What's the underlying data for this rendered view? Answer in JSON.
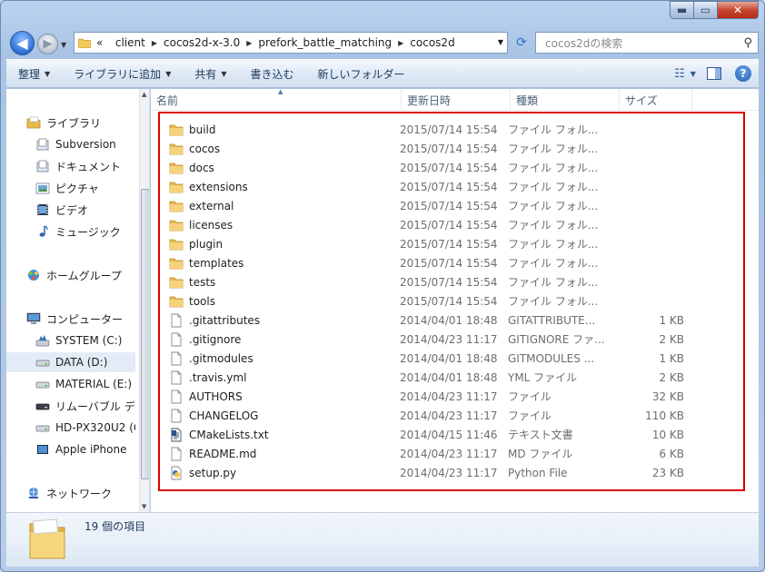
{
  "window": {
    "caption": {
      "minimize": "▬",
      "maximize": "▭",
      "close": "✕"
    }
  },
  "nav": {
    "back": "◀",
    "forward": "▶"
  },
  "address": {
    "overflow": "«",
    "crumbs": [
      "client",
      "cocos2d-x-3.0",
      "prefork_battle_matching",
      "cocos2d"
    ]
  },
  "search": {
    "placeholder": "cocos2dの検索"
  },
  "toolbar": {
    "items": [
      "整理",
      "ライブラリに追加",
      "共有",
      "書き込む",
      "新しいフォルダー"
    ]
  },
  "navpane": {
    "items": [
      {
        "label": "ライブラリ",
        "icon": "library-icon",
        "indent": 0
      },
      {
        "label": "Subversion",
        "icon": "document-library-icon",
        "indent": 1
      },
      {
        "label": "ドキュメント",
        "icon": "document-library-icon",
        "indent": 1
      },
      {
        "label": "ピクチャ",
        "icon": "pictures-icon",
        "indent": 1
      },
      {
        "label": "ビデオ",
        "icon": "video-icon",
        "indent": 1
      },
      {
        "label": "ミュージック",
        "icon": "music-icon",
        "indent": 1
      },
      {
        "label": "ホームグループ",
        "icon": "homegroup-icon",
        "indent": 0
      },
      {
        "label": "コンピューター",
        "icon": "computer-icon",
        "indent": 0
      },
      {
        "label": "SYSTEM (C:)",
        "icon": "system-drive-icon",
        "indent": 1
      },
      {
        "label": "DATA (D:)",
        "icon": "drive-icon",
        "indent": 1
      },
      {
        "label": "MATERIAL (E:)",
        "icon": "drive-icon",
        "indent": 1
      },
      {
        "label": "リムーバブル デ",
        "icon": "removable-drive-icon",
        "indent": 1
      },
      {
        "label": "HD-PX320U2 (G",
        "icon": "drive-icon",
        "indent": 1
      },
      {
        "label": "Apple iPhone",
        "icon": "phone-icon",
        "indent": 1
      },
      {
        "label": "ネットワーク",
        "icon": "network-icon",
        "indent": 0
      }
    ],
    "selected": "DATA (D:)"
  },
  "columns": {
    "name": "名前",
    "date": "更新日時",
    "type": "種類",
    "size": "サイズ"
  },
  "files": [
    {
      "name": "build",
      "date": "2015/07/14 15:54",
      "type": "ファイル フォル...",
      "size": "",
      "icon": "folder-icon"
    },
    {
      "name": "cocos",
      "date": "2015/07/14 15:54",
      "type": "ファイル フォル...",
      "size": "",
      "icon": "folder-icon"
    },
    {
      "name": "docs",
      "date": "2015/07/14 15:54",
      "type": "ファイル フォル...",
      "size": "",
      "icon": "folder-icon"
    },
    {
      "name": "extensions",
      "date": "2015/07/14 15:54",
      "type": "ファイル フォル...",
      "size": "",
      "icon": "folder-icon"
    },
    {
      "name": "external",
      "date": "2015/07/14 15:54",
      "type": "ファイル フォル...",
      "size": "",
      "icon": "folder-icon"
    },
    {
      "name": "licenses",
      "date": "2015/07/14 15:54",
      "type": "ファイル フォル...",
      "size": "",
      "icon": "folder-icon"
    },
    {
      "name": "plugin",
      "date": "2015/07/14 15:54",
      "type": "ファイル フォル...",
      "size": "",
      "icon": "folder-icon"
    },
    {
      "name": "templates",
      "date": "2015/07/14 15:54",
      "type": "ファイル フォル...",
      "size": "",
      "icon": "folder-icon"
    },
    {
      "name": "tests",
      "date": "2015/07/14 15:54",
      "type": "ファイル フォル...",
      "size": "",
      "icon": "folder-icon"
    },
    {
      "name": "tools",
      "date": "2015/07/14 15:54",
      "type": "ファイル フォル...",
      "size": "",
      "icon": "folder-icon"
    },
    {
      "name": ".gitattributes",
      "date": "2014/04/01 18:48",
      "type": "GITATTRIBUTE...",
      "size": "1 KB",
      "icon": "file-icon"
    },
    {
      "name": ".gitignore",
      "date": "2014/04/23 11:17",
      "type": "GITIGNORE ファ...",
      "size": "2 KB",
      "icon": "file-icon"
    },
    {
      "name": ".gitmodules",
      "date": "2014/04/01 18:48",
      "type": "GITMODULES ...",
      "size": "1 KB",
      "icon": "file-icon"
    },
    {
      "name": ".travis.yml",
      "date": "2014/04/01 18:48",
      "type": "YML ファイル",
      "size": "2 KB",
      "icon": "file-icon"
    },
    {
      "name": "AUTHORS",
      "date": "2014/04/23 11:17",
      "type": "ファイル",
      "size": "32 KB",
      "icon": "file-icon"
    },
    {
      "name": "CHANGELOG",
      "date": "2014/04/23 11:17",
      "type": "ファイル",
      "size": "110 KB",
      "icon": "file-icon"
    },
    {
      "name": "CMakeLists.txt",
      "date": "2014/04/15 11:46",
      "type": "テキスト文書",
      "size": "10 KB",
      "icon": "text-file-icon"
    },
    {
      "name": "README.md",
      "date": "2014/04/23 11:17",
      "type": "MD ファイル",
      "size": "6 KB",
      "icon": "file-icon"
    },
    {
      "name": "setup.py",
      "date": "2014/04/23 11:17",
      "type": "Python File",
      "size": "23 KB",
      "icon": "python-file-icon"
    }
  ],
  "status": {
    "count": "19 個の項目"
  },
  "colors": {
    "highlight": "#e00000",
    "folder": "#f2c95c",
    "selection": "#e3ecf6"
  }
}
